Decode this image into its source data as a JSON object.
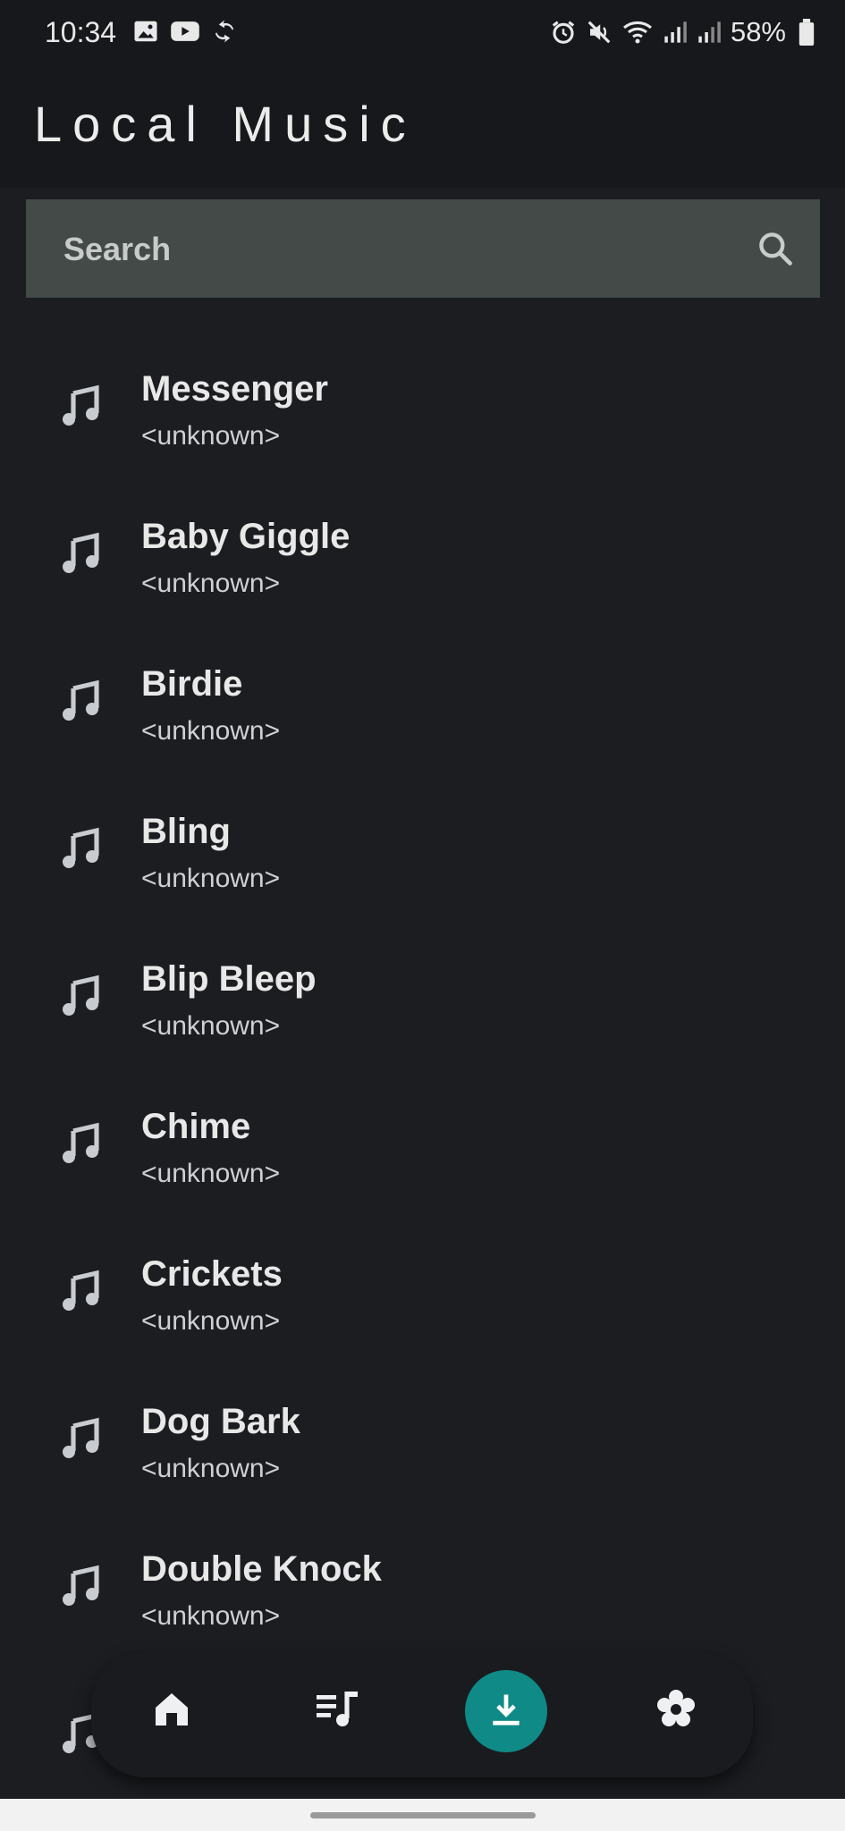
{
  "status_bar": {
    "time": "10:34",
    "battery": "58%",
    "left_icons": [
      "gallery-icon",
      "youtube-icon",
      "sync-icon"
    ],
    "right_icons": [
      "alarm-icon",
      "mute-icon",
      "wifi-icon",
      "signal-icon",
      "signal-icon",
      "battery-icon"
    ]
  },
  "header": {
    "title": "Local Music"
  },
  "search": {
    "placeholder": "Search"
  },
  "songs": [
    {
      "title": "Messenger",
      "artist": "<unknown>"
    },
    {
      "title": "Baby Giggle",
      "artist": "<unknown>"
    },
    {
      "title": "Birdie",
      "artist": "<unknown>"
    },
    {
      "title": "Bling",
      "artist": "<unknown>"
    },
    {
      "title": "Blip Bleep",
      "artist": "<unknown>"
    },
    {
      "title": "Chime",
      "artist": "<unknown>"
    },
    {
      "title": "Crickets",
      "artist": "<unknown>"
    },
    {
      "title": "Dog Bark",
      "artist": "<unknown>"
    },
    {
      "title": "Double Knock",
      "artist": "<unknown>"
    }
  ],
  "bottom_nav": {
    "items": [
      {
        "icon": "home-icon"
      },
      {
        "icon": "playlist-icon"
      },
      {
        "icon": "download-icon",
        "active": true
      },
      {
        "icon": "settings-icon"
      }
    ],
    "accent_color": "#0f8a86"
  },
  "colors": {
    "background": "#1c1d21",
    "header": "#17181b",
    "search_bg": "#434a48"
  }
}
